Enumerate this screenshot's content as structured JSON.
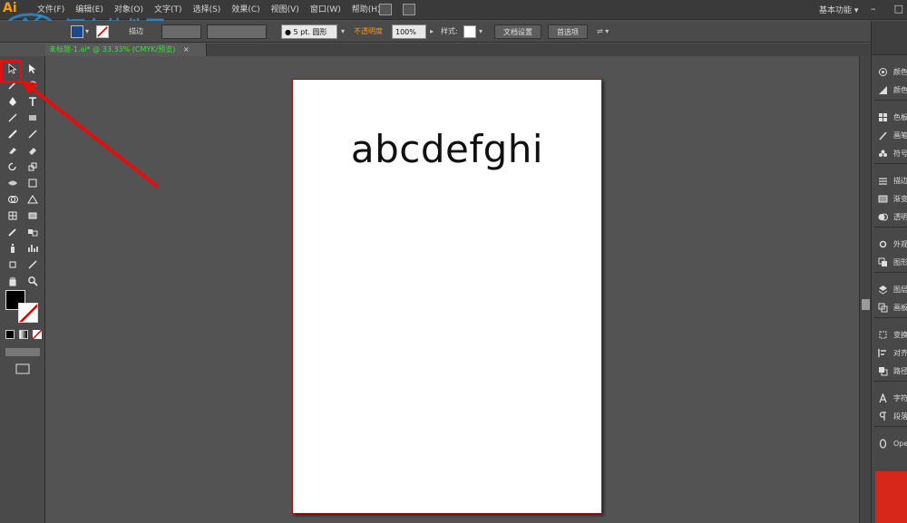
{
  "app": {
    "logo": "Ai",
    "menu": [
      "文件(F)",
      "编辑(E)",
      "对象(O)",
      "文字(T)",
      "选择(S)",
      "效果(C)",
      "视图(V)",
      "窗口(W)",
      "帮助(H)"
    ],
    "workspace": "基本功能",
    "window_controls": [
      "–",
      "□"
    ]
  },
  "watermark": {
    "text": "河东软件园"
  },
  "controlbar": {
    "stroke_label": "描边",
    "brush_label": "● 5 pt. 圆形",
    "opacity_label": "不透明度",
    "opacity_value": "100%",
    "style_label": "样式:",
    "doc_setup_button": "文档设置",
    "preferences_button": "首选项"
  },
  "document_tab": {
    "label": "未标题-1.ai* @ 33.33% (CMYK/预览)",
    "close": "×"
  },
  "artboard": {
    "text": "abcdefghi"
  },
  "panels": {
    "items": [
      {
        "icon": "color-icon",
        "label": "颜色"
      },
      {
        "icon": "color-guide-icon",
        "label": "颜色参考"
      },
      {
        "icon": "swatches-icon",
        "label": "色板"
      },
      {
        "icon": "brushes-icon",
        "label": "画笔"
      },
      {
        "icon": "symbols-icon",
        "label": "符号"
      },
      {
        "icon": "stroke-icon",
        "label": "描边"
      },
      {
        "icon": "gradient-icon",
        "label": "渐变"
      },
      {
        "icon": "transparency-icon",
        "label": "透明度"
      },
      {
        "icon": "appearance-icon",
        "label": "外观"
      },
      {
        "icon": "graphic-styles-icon",
        "label": "图形样式"
      },
      {
        "icon": "layers-icon",
        "label": "图层"
      },
      {
        "icon": "artboards-icon",
        "label": "画板"
      },
      {
        "icon": "transform-icon",
        "label": "变换"
      },
      {
        "icon": "align-icon",
        "label": "对齐"
      },
      {
        "icon": "pathfinder-icon",
        "label": "路径查找器"
      },
      {
        "icon": "character-icon",
        "label": "字符"
      },
      {
        "icon": "paragraph-icon",
        "label": "段落"
      },
      {
        "icon": "opentype-icon",
        "label": "OpenType"
      }
    ]
  },
  "colors": {
    "accent_highlight": "#e01010",
    "document_tab_text": "#35e23a",
    "logo": "#ff9a00"
  }
}
